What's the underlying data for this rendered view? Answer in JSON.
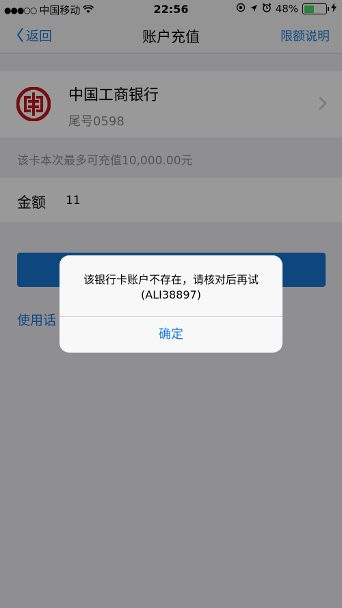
{
  "status_bar": {
    "signal_dots": "●●●○○",
    "carrier": "中国移动",
    "wifi_icon": "wifi-icon",
    "time": "22:56",
    "battery_percent": "48%",
    "battery_level": 0.48,
    "battery_color": "#4cd964"
  },
  "nav": {
    "back_label": "返回",
    "title": "账户充值",
    "right_label": "限额说明"
  },
  "bank": {
    "name": "中国工商银行",
    "tail": "尾号0598",
    "logo_color": "#c4161c"
  },
  "limit_hint": "该卡本次最多可充值10,000.00元",
  "amount": {
    "label": "金额",
    "value": "11"
  },
  "terms_link": "使用话",
  "alert": {
    "message_line1": "该银行卡账户不存在，请核对后再试",
    "message_line2": "(ALI38897)",
    "confirm_label": "确定"
  },
  "colors": {
    "accent": "#1a7ad9",
    "primary_button": "#1677d2"
  }
}
